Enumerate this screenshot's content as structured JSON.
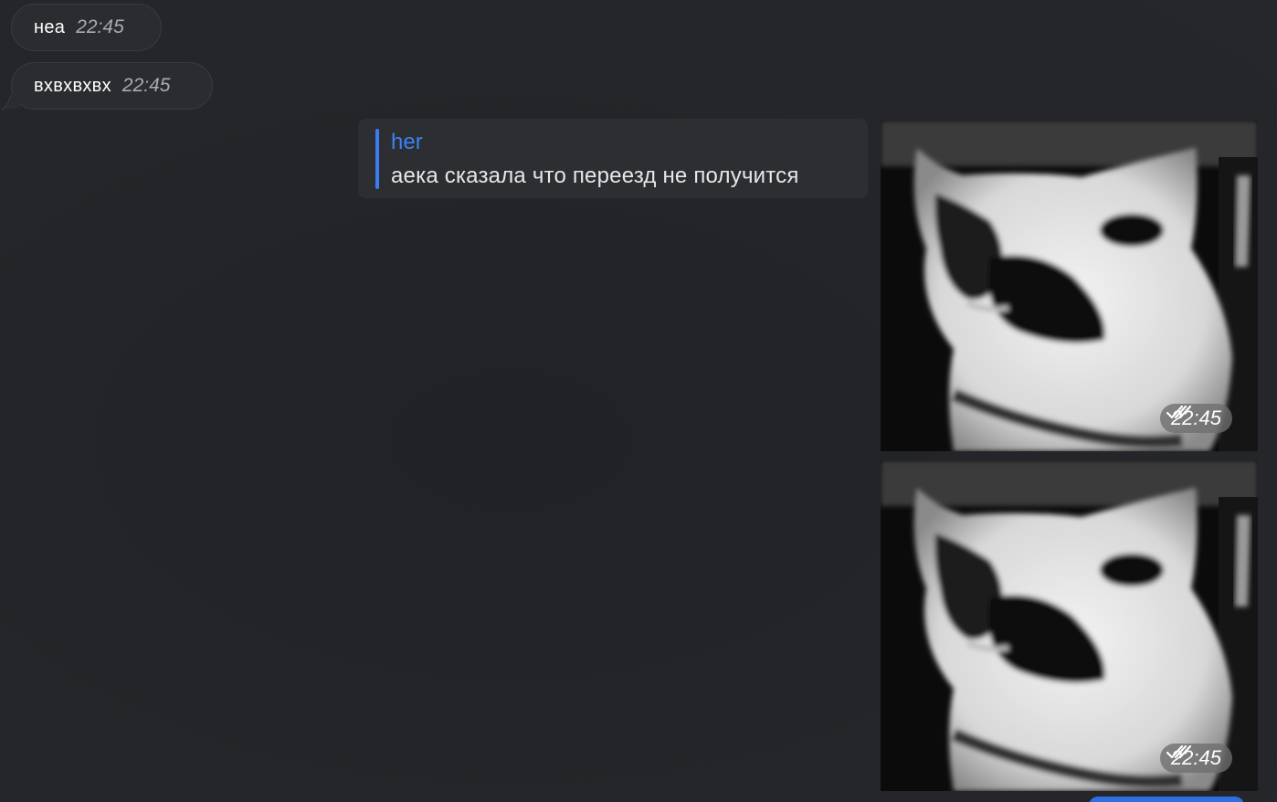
{
  "messages": [
    {
      "text": "неа",
      "time": "22:45"
    },
    {
      "text": "вхвхвхвх",
      "time": "22:45"
    }
  ],
  "reply": {
    "author": "her",
    "text": "аека сказала что переезд не получится"
  },
  "photos": [
    {
      "time": "22:45",
      "status": "read-double-check-icon"
    },
    {
      "time": "22:45",
      "status": "read-double-check-icon"
    }
  ],
  "colors": {
    "background": "#222427",
    "incoming_bubble": "#2b2c2f",
    "accent": "#3b82f6",
    "stamp": "#6e6e70"
  }
}
